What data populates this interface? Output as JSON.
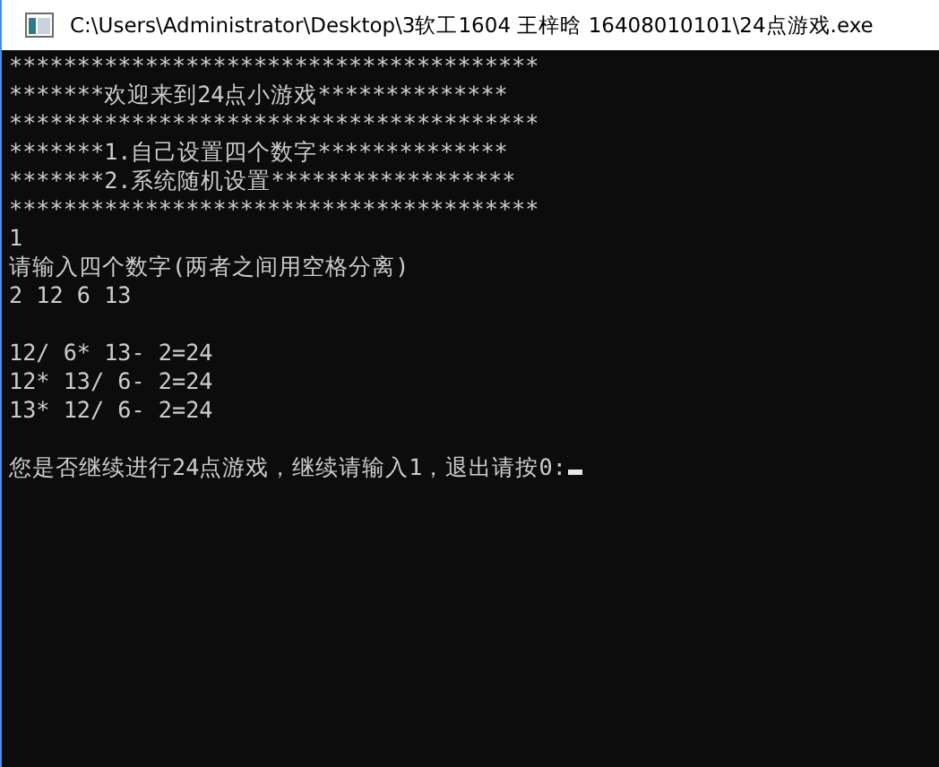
{
  "window": {
    "title": "C:\\Users\\Administrator\\Desktop\\3软工1604 王梓晗 16408010101\\24点游戏.exe"
  },
  "console": {
    "blocks": [
      [
        "***************************************",
        "*******欢迎来到24点小游戏**************",
        "***************************************",
        "*******1.自己设置四个数字**************",
        "*******2.系统随机设置******************",
        "***************************************",
        "1",
        "请输入四个数字(两者之间用空格分离)",
        "2 12 6 13"
      ],
      [
        "12/ 6* 13- 2=24",
        "12* 13/ 6- 2=24",
        "13* 12/ 6- 2=24"
      ],
      [
        "您是否继续进行24点游戏，继续请输入1，退出请按0:"
      ]
    ]
  }
}
